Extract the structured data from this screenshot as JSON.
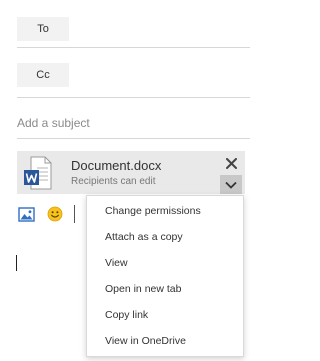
{
  "recipients": {
    "to_label": "To",
    "cc_label": "Cc"
  },
  "subject": {
    "placeholder": "Add a subject",
    "value": ""
  },
  "attachment": {
    "file_name": "Document.docx",
    "permission_note": "Recipients can edit",
    "icon": "word-document-icon"
  },
  "toolbar": {
    "icons": [
      "insert-picture-icon",
      "emoji-icon"
    ]
  },
  "attachment_menu": {
    "items": [
      "Change permissions",
      "Attach as a copy",
      "View",
      "Open in new tab",
      "Copy link",
      "View in OneDrive"
    ]
  },
  "colors": {
    "word_blue": "#2b579a",
    "emoji_yellow": "#f6c21b",
    "picture_blue": "#2f6fc2",
    "card_bg": "#e9e9e9"
  }
}
